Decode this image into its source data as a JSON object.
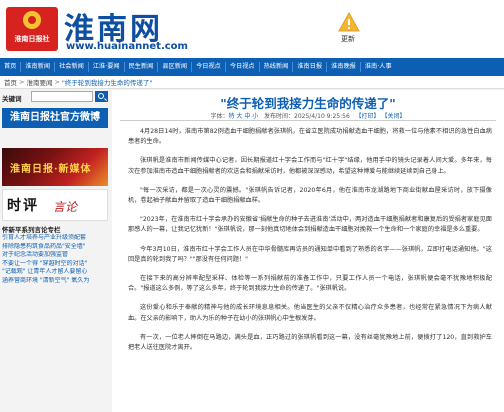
{
  "header": {
    "logo_text": "淮南日报社",
    "site_name": "淮南网",
    "site_url": "www.huainannet.com",
    "update_label": "更新",
    "accent_color": "#0d5fb3",
    "brand_red": "#d6231f"
  },
  "nav": {
    "items": [
      "首页",
      "淮南新闻",
      "社会新闻",
      "江淮·要闻",
      "民生新闻",
      "县区新闻",
      "今日视点",
      "今日视点",
      "热线新闻",
      "淮南日报",
      "淮南晚报",
      "淮南·人事"
    ]
  },
  "breadcrumb": {
    "items": [
      "首页",
      "淮南要闻",
      "\"终于轮到我接力生命的传递了\""
    ],
    "separator": ">"
  },
  "sidebar": {
    "search_label": "关键词",
    "search_value": "",
    "banner_weibo": "淮南日报社官方微博",
    "banner_image_text": "淮南日报·新媒体",
    "banner_comment_big": "时评",
    "banner_comment_small": "言论",
    "section_title": "怀新平系列言论专栏",
    "list": [
      "引育人才培养与产业升级须配套",
      "排除隐患构筑食品药品\"安全墙\"",
      "对于纪念活动要加强监管",
      "不要让一个得 \"穿越时空的对话\"",
      "\"记载观\" 让青年人才留人要留心",
      "涵养营商环境 \"清新空气\" 氧久为"
    ]
  },
  "article": {
    "title": "\"终于轮到我接力生命的传递了\"",
    "meta_prefix": "字体：",
    "font_sizes": "特 大 中 小",
    "publish_label": "发布时间：",
    "publish_time": "2025/4/10 9:25:56",
    "print_label": "【打印】",
    "close_label": "【关闭】",
    "paragraphs": [
      "4月28日14时，淮南市第82例造血干细胞捐献者张琪帆，在省立医院成功捐献造血干细胞，将救一位与他素不相识的急性白血病患者的生命。",
      "张琪帆是淮南市新闻传媒中心记者，因长期报道红十字会工作而与\"红十字\"结缘，他用手中的镜头记录着人间大爱。多年来，每次在参加淮南市造血干细胞捐献者的欢送会和捐献采访时，他都被深深感动，希望这种博爱与能继续延续到自己身上。",
      "\"每一次采访，都是一次心灵的震撼。\"张琪帆告诉记者，2020年6月，他在淮南市龙湖路地下商业街献血屋采访时，放下摄像机，卷起袖子献血并留取了造血干细胞捐献血样。",
      "\"2023年，在淮南市红十字会承办的安徽省'捐献生命的种子去进淮南'活动中，两对造血干细胞捐献者和康复后的受捐者家庭见面那感人的一幕，让我记忆犹新！\"张琪帆说，那一刻他真切地体会到捐献造血干细胞对挽救一个生命和一个家庭的幸福是多么重要。",
      "今年3月10日，淮南市红十字会工作人员在中华骨髓库再访员的通知单中看到了熟悉的名字——张琪帆，立即打电话通知他。\"这回是真的轮到我了吗？\"\"那没有任何问题！\"",
      "在接下来的高分辨率配型采样、体检等一系列捐献前的准备工作中，只要工作人员一个电话，张琪帆便会毫不犹豫地积极配合。\"报道这么多例，等了这么多年，终于轮到我接力生命的传递了。\"张琪帆说。",
      "这份爱心和乐于奉献的精神与他的成长环境息息相关。他当医生的父亲不仅精心治疗众多患者，也经常在紧急情况下为病人献血。在父亲的影响下，助人为乐的种子在幼小的张琪帆心中生根发芽。",
      "有一次，一位老人摔倒在马路边，满头是血，正巧路过的张琪帆看到这一幕，没有丝毫犹豫地上前，便拨打了120，直到救护车把老人送往医院才离开。"
    ]
  }
}
